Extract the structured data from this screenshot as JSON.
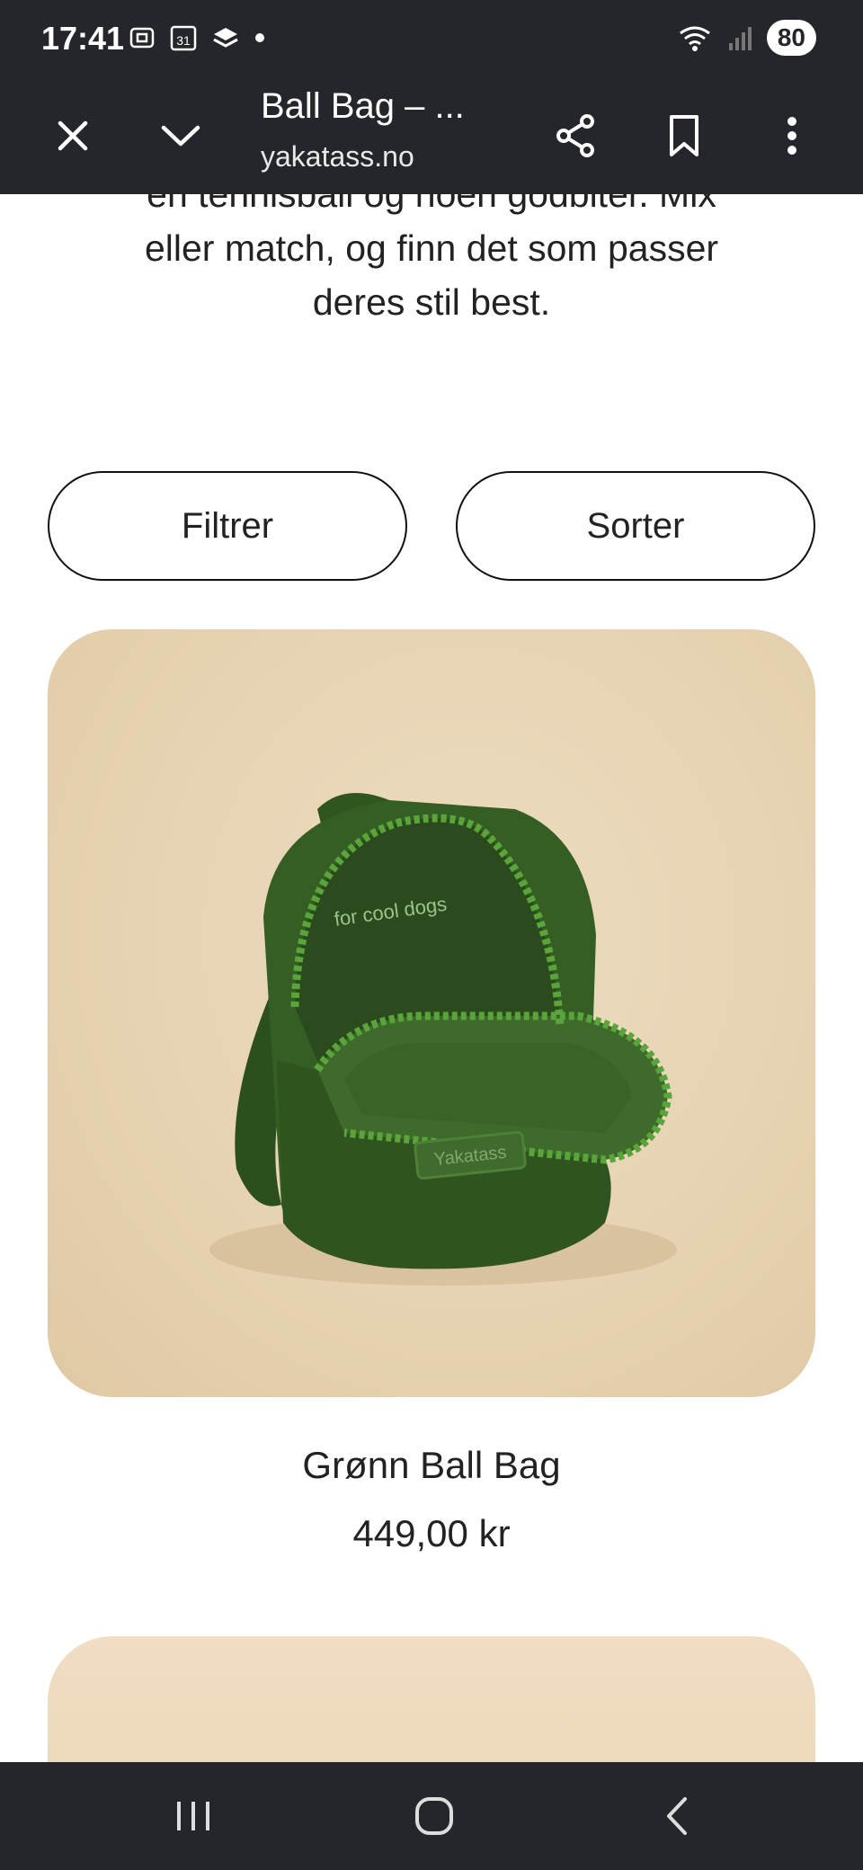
{
  "status_bar": {
    "time": "17:41",
    "calendar_day": "31",
    "battery": "80"
  },
  "toolbar": {
    "title": "Ball Bag – ...",
    "url": "yakatass.no"
  },
  "page": {
    "intro_line_1": "en tennisball og noen godbiter. Mix",
    "intro_line_2": "eller match, og finn det som passer",
    "intro_line_3": "deres stil best.",
    "filter_label": "Filtrer",
    "sort_label": "Sorter",
    "products": [
      {
        "name": "Grønn Ball Bag",
        "price": "449,00 kr",
        "image_lining_text": "for cool dogs",
        "image_patch_text": "Yakatass"
      }
    ]
  },
  "colors": {
    "chrome": "#24262b",
    "card_bg": "#e7d3b3",
    "bag_green": "#355e25",
    "chat_fab": "#2c3e50"
  },
  "icons": {
    "close": "close-icon",
    "chevron": "chevron-down-icon",
    "share": "share-icon",
    "bookmark": "bookmark-icon",
    "menu": "more-vert-icon",
    "chat": "chat-icon",
    "recents": "recents-icon",
    "home": "home-icon",
    "back": "back-icon"
  }
}
